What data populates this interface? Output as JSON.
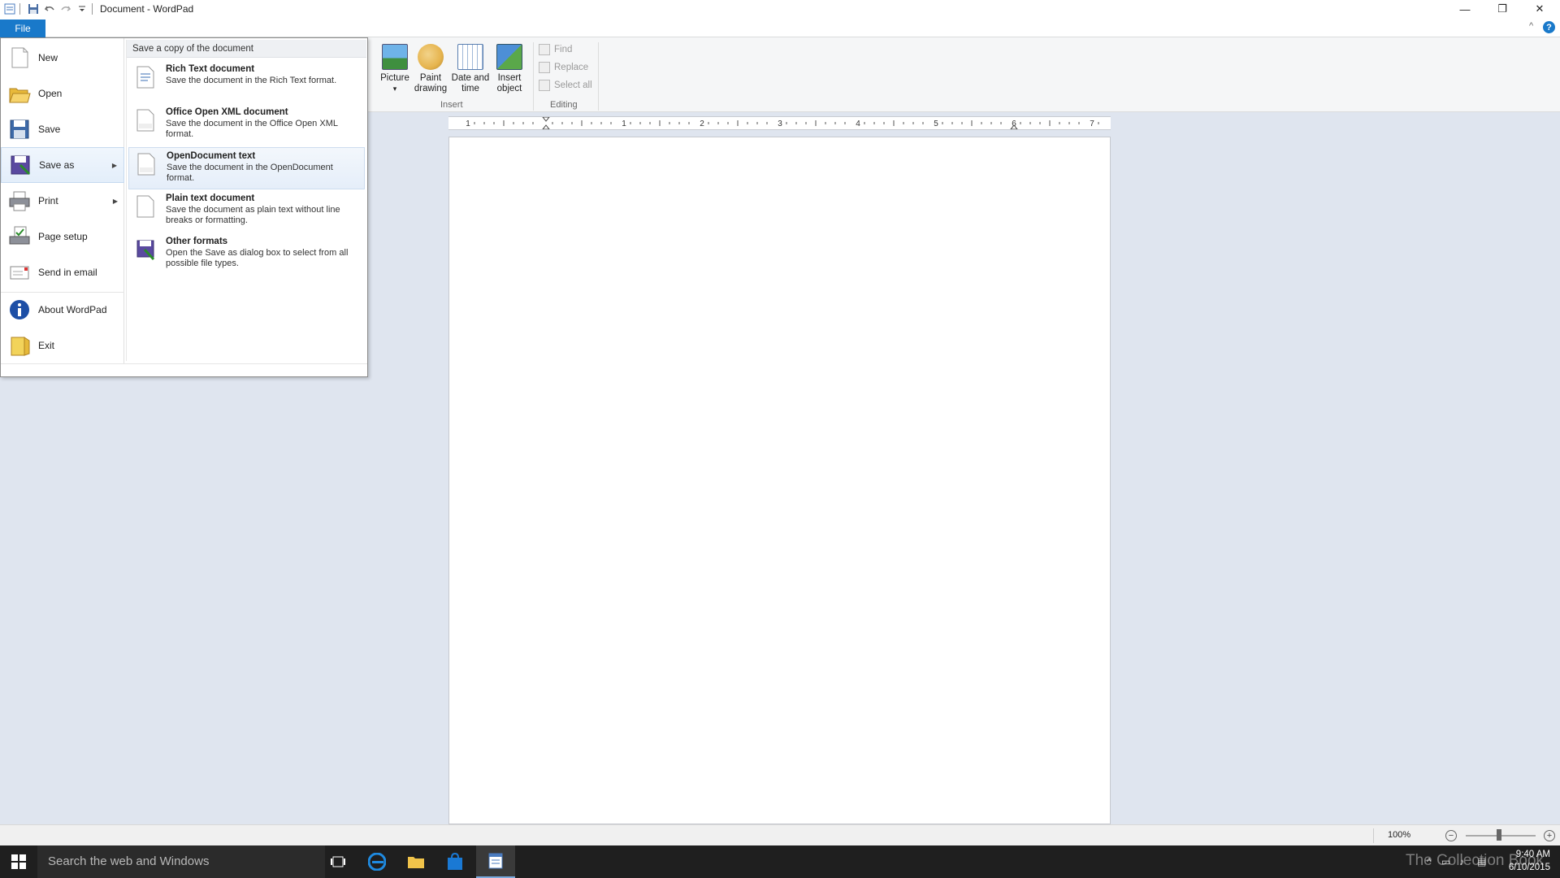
{
  "window": {
    "title": "Document - WordPad",
    "minimize": "—",
    "restore": "❐",
    "close": "✕"
  },
  "ribbon": {
    "file_tab": "File",
    "insert_group_label": "Insert",
    "editing_group_label": "Editing",
    "picture_label": "Picture",
    "picture_arrow": "▾",
    "paint_label_1": "Paint",
    "paint_label_2": "drawing",
    "datetime_label_1": "Date and",
    "datetime_label_2": "time",
    "insert_obj_label_1": "Insert",
    "insert_obj_label_2": "object",
    "find_label": "Find",
    "replace_label": "Replace",
    "select_all_label": "Select all",
    "collapse_caret": "^",
    "help": "?"
  },
  "ruler": {
    "numbers": [
      "1",
      "1",
      "2",
      "3",
      "4",
      "5",
      "6",
      "7"
    ]
  },
  "file_menu": {
    "items": [
      {
        "label": "New",
        "icon": "new-document-icon"
      },
      {
        "label": "Open",
        "icon": "open-folder-icon"
      },
      {
        "label": "Save",
        "icon": "save-disk-icon"
      },
      {
        "label": "Save as",
        "icon": "save-as-icon",
        "submenu_arrow": "▶"
      },
      {
        "label": "Print",
        "icon": "printer-icon",
        "submenu_arrow": "▶"
      },
      {
        "label": "Page setup",
        "icon": "page-setup-icon"
      },
      {
        "label": "Send in email",
        "icon": "email-icon"
      },
      {
        "label": "About WordPad",
        "icon": "info-icon"
      },
      {
        "label": "Exit",
        "icon": "exit-icon"
      }
    ],
    "submenu_header": "Save a copy of the document",
    "submenu": [
      {
        "title": "Rich Text document",
        "desc": "Save the document in the Rich Text format."
      },
      {
        "title": "Office Open XML document",
        "desc": "Save the document in the Office Open XML format."
      },
      {
        "title": "OpenDocument text",
        "desc": "Save the document in the OpenDocument format."
      },
      {
        "title": "Plain text document",
        "desc": "Save the document as plain text without line breaks or formatting."
      },
      {
        "title": "Other formats",
        "desc": "Open the Save as dialog box to select from all possible file types."
      }
    ]
  },
  "statusbar": {
    "zoom": "100%",
    "zoom_out": "−",
    "zoom_in": "+"
  },
  "taskbar": {
    "search_placeholder": "Search the web and Windows",
    "time": "9:40 AM",
    "date": "6/10/2015",
    "watermark": "The Collection Book"
  },
  "colors": {
    "accent": "#1979ca",
    "taskbar": "#1f1f1f",
    "workspace": "#dfe5ef"
  }
}
